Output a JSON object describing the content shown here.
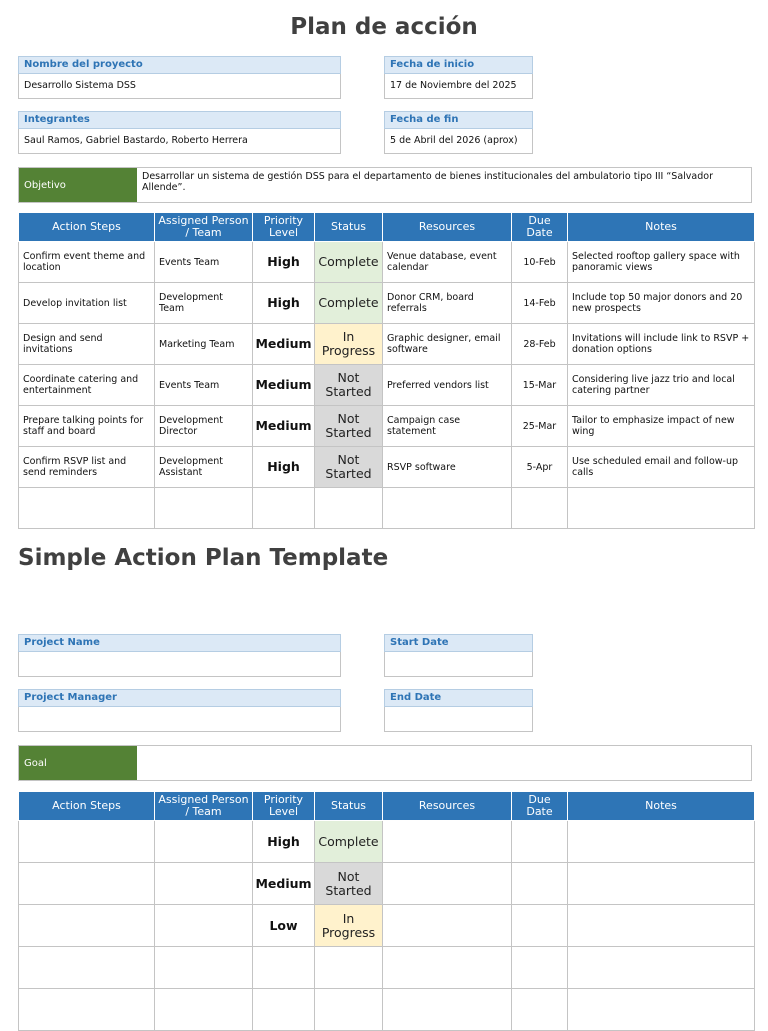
{
  "section1": {
    "title": "Plan de acción",
    "project_name_label": "Nombre del proyecto",
    "project_name_value": "Desarrollo Sistema DSS",
    "start_date_label": "Fecha de inicio",
    "start_date_value": "17 de Noviembre del 2025",
    "members_label": "Integrantes",
    "members_value": "Saul Ramos, Gabriel Bastardo, Roberto Herrera",
    "end_date_label": "Fecha de fin",
    "end_date_value": "5 de Abril del 2026 (aprox)",
    "goal_label": "Objetivo",
    "goal_value": "Desarrollar un sistema de gestión DSS para el departamento de bienes institucionales del ambulatorio tipo III “Salvador Allende”."
  },
  "table_headers": [
    "Action Steps",
    "Assigned Person / Team",
    "Priority Level",
    "Status",
    "Resources",
    "Due Date",
    "Notes"
  ],
  "table1_rows": [
    {
      "step": "Confirm event theme and location",
      "assigned": "Events Team",
      "priority": "High",
      "status": "Complete",
      "resources": "Venue database, event calendar",
      "due": "10-Feb",
      "notes": "Selected rooftop gallery space with panoramic views"
    },
    {
      "step": "Develop invitation list",
      "assigned": "Development Team",
      "priority": "High",
      "status": "Complete",
      "resources": "Donor CRM, board referrals",
      "due": "14-Feb",
      "notes": "Include top 50 major donors and 20 new prospects"
    },
    {
      "step": "Design and send invitations",
      "assigned": "Marketing Team",
      "priority": "Medium",
      "status": "In Progress",
      "resources": "Graphic designer, email software",
      "due": "28-Feb",
      "notes": "Invitations will include link to RSVP + donation options"
    },
    {
      "step": "Coordinate catering and entertainment",
      "assigned": "Events Team",
      "priority": "Medium",
      "status": "Not Started",
      "resources": "Preferred vendors list",
      "due": "15-Mar",
      "notes": "Considering live jazz trio and local catering partner"
    },
    {
      "step": "Prepare talking points for staff and board",
      "assigned": "Development Director",
      "priority": "Medium",
      "status": "Not Started",
      "resources": "Campaign case statement",
      "due": "25-Mar",
      "notes": "Tailor to emphasize impact of new wing"
    },
    {
      "step": "Confirm RSVP list and send reminders",
      "assigned": "Development Assistant",
      "priority": "High",
      "status": "Not Started",
      "resources": "RSVP software",
      "due": "5-Apr",
      "notes": "Use scheduled email and follow-up calls"
    },
    {
      "step": "",
      "assigned": "",
      "priority": "",
      "status": "",
      "resources": "",
      "due": "",
      "notes": ""
    }
  ],
  "section2": {
    "title": "Simple Action Plan Template",
    "project_name_label": "Project Name",
    "project_name_value": "",
    "start_date_label": "Start Date",
    "start_date_value": "",
    "manager_label": "Project Manager",
    "manager_value": "",
    "end_date_label": "End Date",
    "end_date_value": "",
    "goal_label": "Goal",
    "goal_value": ""
  },
  "table2_rows": [
    {
      "step": "",
      "assigned": "",
      "priority": "High",
      "status": "Complete",
      "resources": "",
      "due": "",
      "notes": ""
    },
    {
      "step": "",
      "assigned": "",
      "priority": "Medium",
      "status": "Not Started",
      "resources": "",
      "due": "",
      "notes": ""
    },
    {
      "step": "",
      "assigned": "",
      "priority": "Low",
      "status": "In Progress",
      "resources": "",
      "due": "",
      "notes": ""
    },
    {
      "step": "",
      "assigned": "",
      "priority": "",
      "status": "",
      "resources": "",
      "due": "",
      "notes": ""
    },
    {
      "step": "",
      "assigned": "",
      "priority": "",
      "status": "",
      "resources": "",
      "due": "",
      "notes": ""
    }
  ],
  "colors": {
    "header_blue": "#2e75b6",
    "label_blue": "#2e74b5",
    "label_bg": "#dce9f6",
    "goal_green": "#548235",
    "priority_high": "#c00000",
    "priority_medium": "#ed9500",
    "priority_low": "#00a33a",
    "status_complete_bg": "#e2efda",
    "status_in_progress_bg": "#fff2cc",
    "status_not_started_bg": "#d9d9d9"
  }
}
